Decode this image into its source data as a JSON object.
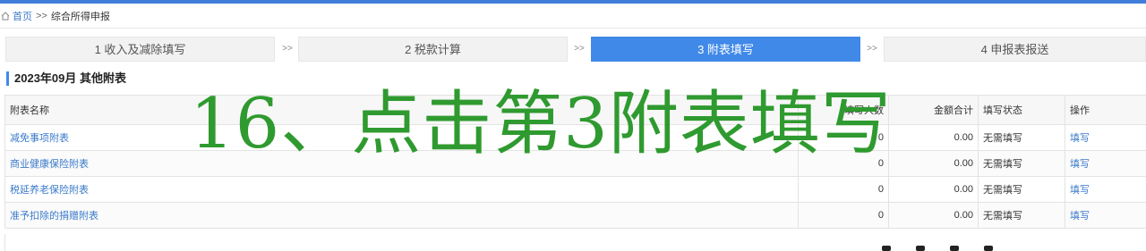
{
  "breadcrumb": {
    "home": "首页",
    "separator": ">>",
    "current": "综合所得申报"
  },
  "steps": [
    {
      "label": "1 收入及减除填写"
    },
    {
      "label": "2 税款计算"
    },
    {
      "label": "3 附表填写"
    },
    {
      "label": "4 申报表报送"
    }
  ],
  "step_separator": ">>",
  "section_title": "2023年09月  其他附表",
  "table": {
    "headers": {
      "name": "附表名称",
      "count": "填写人数",
      "amount": "金额合计",
      "status": "填写状态",
      "action": "操作"
    },
    "rows": [
      {
        "name": "减免事项附表",
        "count": "0",
        "amount": "0.00",
        "status": "无需填写",
        "action": "填写"
      },
      {
        "name": "商业健康保险附表",
        "count": "0",
        "amount": "0.00",
        "status": "无需填写",
        "action": "填写"
      },
      {
        "name": "税延养老保险附表",
        "count": "0",
        "amount": "0.00",
        "status": "无需填写",
        "action": "填写"
      },
      {
        "name": "准予扣除的捐赠附表",
        "count": "0",
        "amount": "0.00",
        "status": "无需填写",
        "action": "填写"
      }
    ]
  },
  "annotation": "16、点击第3附表填写",
  "colors": {
    "accent": "#4189e8",
    "link": "#3a7ac9",
    "annotation": "#2f9a2f"
  }
}
